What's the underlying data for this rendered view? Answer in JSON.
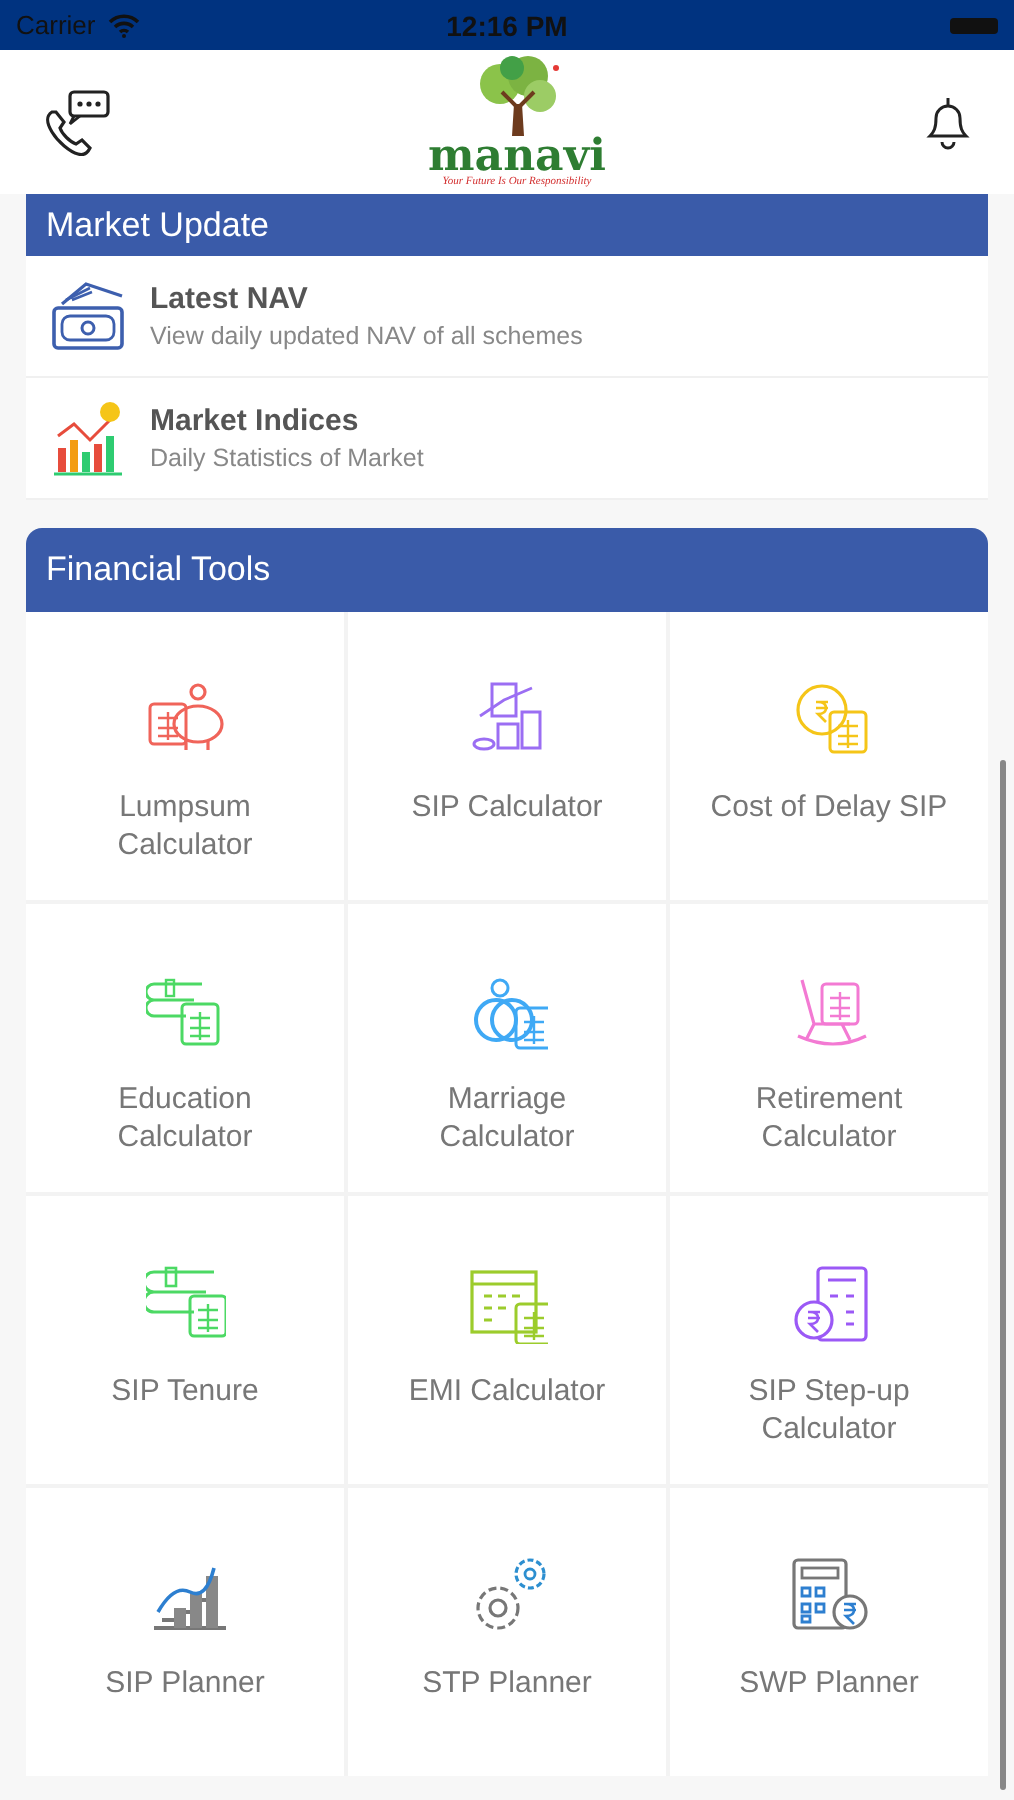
{
  "status_bar": {
    "carrier": "Carrier",
    "time": "12:16 PM"
  },
  "header": {
    "brand": "manavi",
    "tagline": "Your Future Is Our Responsibility"
  },
  "market_update": {
    "title": "Market Update",
    "items": [
      {
        "title": "Latest NAV",
        "subtitle": "View daily updated NAV of all schemes"
      },
      {
        "title": "Market Indices",
        "subtitle": "Daily Statistics of Market"
      }
    ]
  },
  "financial_tools": {
    "title": "Financial Tools",
    "tools": [
      {
        "label": "Lumpsum Calculator"
      },
      {
        "label": "SIP Calculator"
      },
      {
        "label": "Cost of Delay SIP"
      },
      {
        "label": "Education Calculator"
      },
      {
        "label": "Marriage Calculator"
      },
      {
        "label": "Retirement Calculator"
      },
      {
        "label": "SIP Tenure"
      },
      {
        "label": "EMI Calculator"
      },
      {
        "label": "SIP Step-up Calculator"
      },
      {
        "label": "SIP Planner"
      },
      {
        "label": "STP Planner"
      },
      {
        "label": "SWP Planner"
      }
    ]
  }
}
